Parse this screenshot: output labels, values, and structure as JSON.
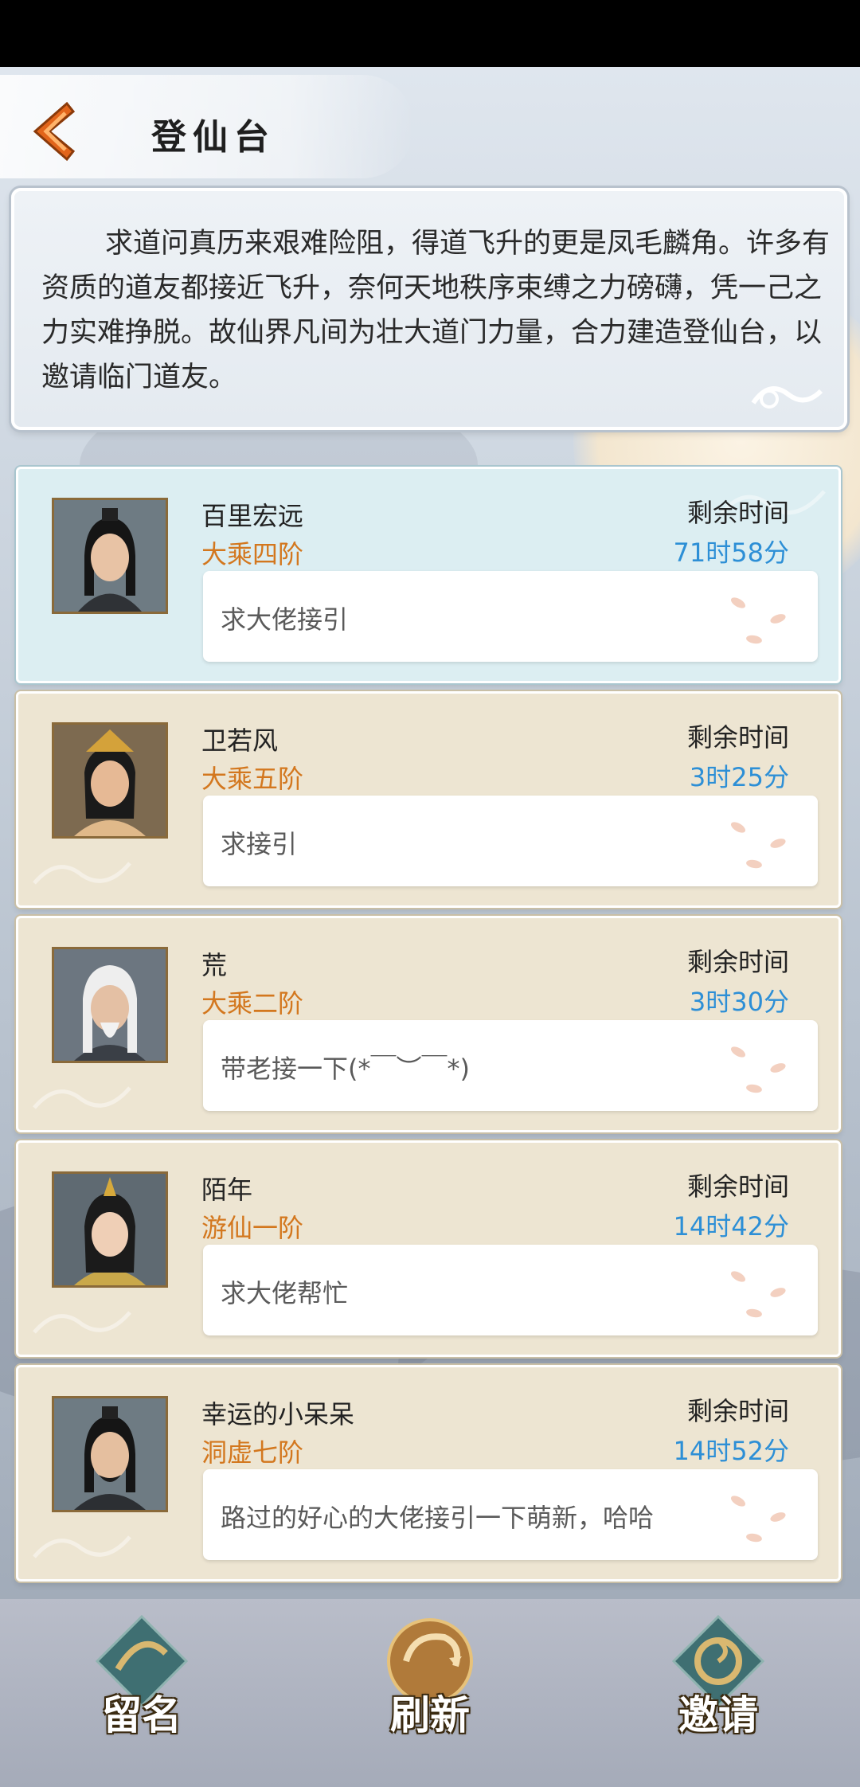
{
  "header": {
    "title": "登仙台",
    "back_icon": "back-arrow-icon"
  },
  "intro": {
    "text": "求道问真历来艰难险阻，得道飞升的更是凤毛麟角。许多有资质的道友都接近飞升，奈何天地秩序束缚之力磅礴，凭一己之力实难挣脱。故仙界凡间为壮大道门力量，合力建造登仙台，以邀请临门道友。"
  },
  "list": {
    "remain_label": "剩余时间",
    "items": [
      {
        "name": "百里宏远",
        "rank": "大乘四阶",
        "remain": "71时58分",
        "message": "求大佬接引"
      },
      {
        "name": "卫若风",
        "rank": "大乘五阶",
        "remain": "3时25分",
        "message": "求接引"
      },
      {
        "name": "荒",
        "rank": "大乘二阶",
        "remain": "3时30分",
        "message": "带老接一下(*￣︶￣*)"
      },
      {
        "name": "陌年",
        "rank": "游仙一阶",
        "remain": "14时42分",
        "message": "求大佬帮忙"
      },
      {
        "name": "幸运的小呆呆",
        "rank": "洞虚七阶",
        "remain": "14时52分",
        "message": "路过的好心的大佬接引一下萌新，哈哈"
      }
    ]
  },
  "actions": {
    "leave_name": "留名",
    "refresh": "刷新",
    "invite": "邀请"
  },
  "colors": {
    "rank": "#d3771e",
    "remain": "#2d8fd6",
    "first_card": "#dceef2",
    "card": "#ede5d2"
  }
}
